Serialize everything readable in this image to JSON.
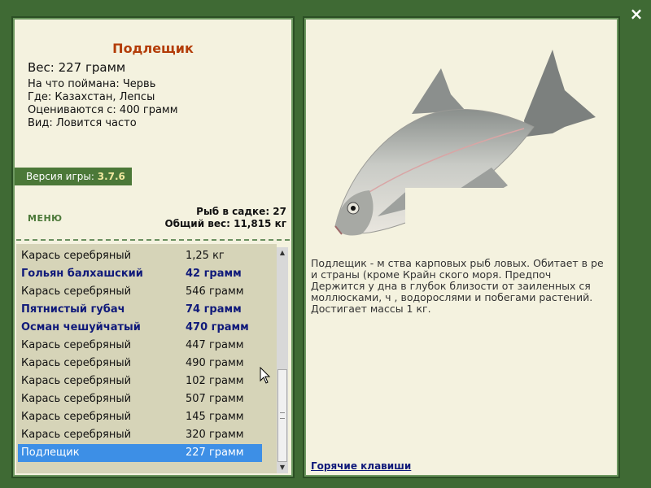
{
  "close_label": "×",
  "fish": {
    "title": "Подлещик",
    "weight": "Вес: 227 грамм",
    "caught_on": "На что поймана: Червь",
    "where": "Где: Казахстан, Лепсы",
    "valued_from": "Оцениваются с: 400 грамм",
    "kind": "Вид: Ловится часто"
  },
  "version": {
    "label": "Версия игры:",
    "number": "3.7.6"
  },
  "menu_label": "МЕНЮ",
  "stats": {
    "fish_in_keepnet": "Рыб в садке: 27",
    "total_weight": "Общий вес: 11,815 кг"
  },
  "catch_list": [
    {
      "name": "Карась серебряный",
      "weight": "1,25 кг",
      "bold": false,
      "selected": false
    },
    {
      "name": "Гольян балхашский",
      "weight": "42 грамм",
      "bold": true,
      "selected": false
    },
    {
      "name": "Карась серебряный",
      "weight": "546 грамм",
      "bold": false,
      "selected": false
    },
    {
      "name": "Пятнистый губач",
      "weight": "74 грамм",
      "bold": true,
      "selected": false
    },
    {
      "name": "Осман чешуйчатый",
      "weight": "470 грамм",
      "bold": true,
      "selected": false
    },
    {
      "name": "Карась серебряный",
      "weight": "447 грамм",
      "bold": false,
      "selected": false
    },
    {
      "name": "Карась серебряный",
      "weight": "490 грамм",
      "bold": false,
      "selected": false
    },
    {
      "name": "Карась серебряный",
      "weight": "102 грамм",
      "bold": false,
      "selected": false
    },
    {
      "name": "Карась серебряный",
      "weight": "507 грамм",
      "bold": false,
      "selected": false
    },
    {
      "name": "Карась серебряный",
      "weight": "145 грамм",
      "bold": false,
      "selected": false
    },
    {
      "name": "Карась серебряный",
      "weight": "320 грамм",
      "bold": false,
      "selected": false
    },
    {
      "name": "Подлещик",
      "weight": "227 грамм",
      "bold": false,
      "selected": true
    }
  ],
  "description": "Подлещик - м                                      ства карповых рыб                                            ловых. Обитает в ре                                        и страны (кроме Крайн                                          ского моря. Предпоч                                       Держится у дна в глубок                                        близости от заиленных                                          ся моллюсками, ч                                              , водорослями и побегами растений. Достигает массы 1 кг.",
  "hotkeys_label": "Горячие клавиши",
  "colors": {
    "background": "#3f6a34",
    "panel": "#f4f2df",
    "title": "#b33d09",
    "selection": "#3d8fe6",
    "bold_row": "#101a7a"
  }
}
